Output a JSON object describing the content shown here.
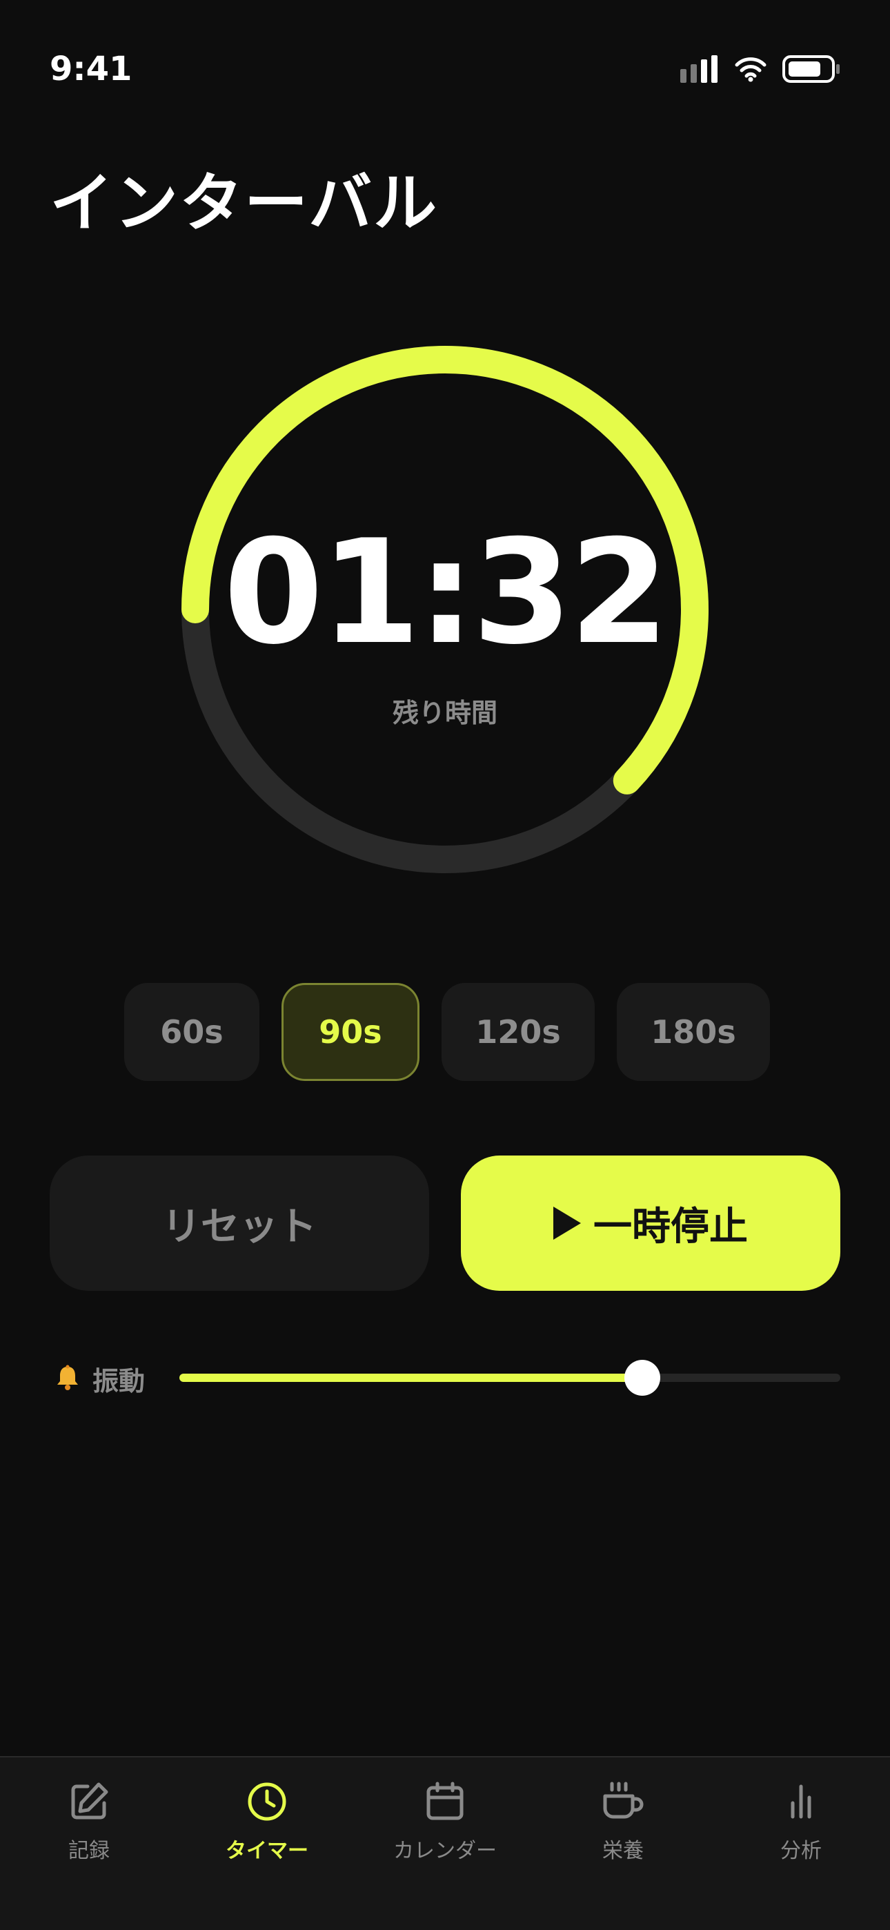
{
  "status_bar": {
    "time": "9:41"
  },
  "page": {
    "title": "インターバル"
  },
  "timer": {
    "remaining": "01:32",
    "caption": "残り時間",
    "progress_fraction": 0.62
  },
  "presets": [
    {
      "label": "60s",
      "active": false
    },
    {
      "label": "90s",
      "active": true
    },
    {
      "label": "120s",
      "active": false
    },
    {
      "label": "180s",
      "active": false
    }
  ],
  "actions": {
    "reset_label": "リセット",
    "pause_label": "一時停止"
  },
  "vibration": {
    "label": "振動",
    "icon": "bell-icon",
    "level_fraction": 0.7
  },
  "tabs": [
    {
      "label": "記録",
      "icon": "edit-icon",
      "active": false
    },
    {
      "label": "タイマー",
      "icon": "clock-icon",
      "active": true
    },
    {
      "label": "カレンダー",
      "icon": "calendar-icon",
      "active": false
    },
    {
      "label": "栄養",
      "icon": "cup-icon",
      "active": false
    },
    {
      "label": "分析",
      "icon": "bar-chart-icon",
      "active": false
    }
  ],
  "colors": {
    "accent": "#e5fb4a",
    "background": "#0d0d0d",
    "ring_track": "#2a2a2a",
    "muted_text": "#8c8c8c"
  }
}
